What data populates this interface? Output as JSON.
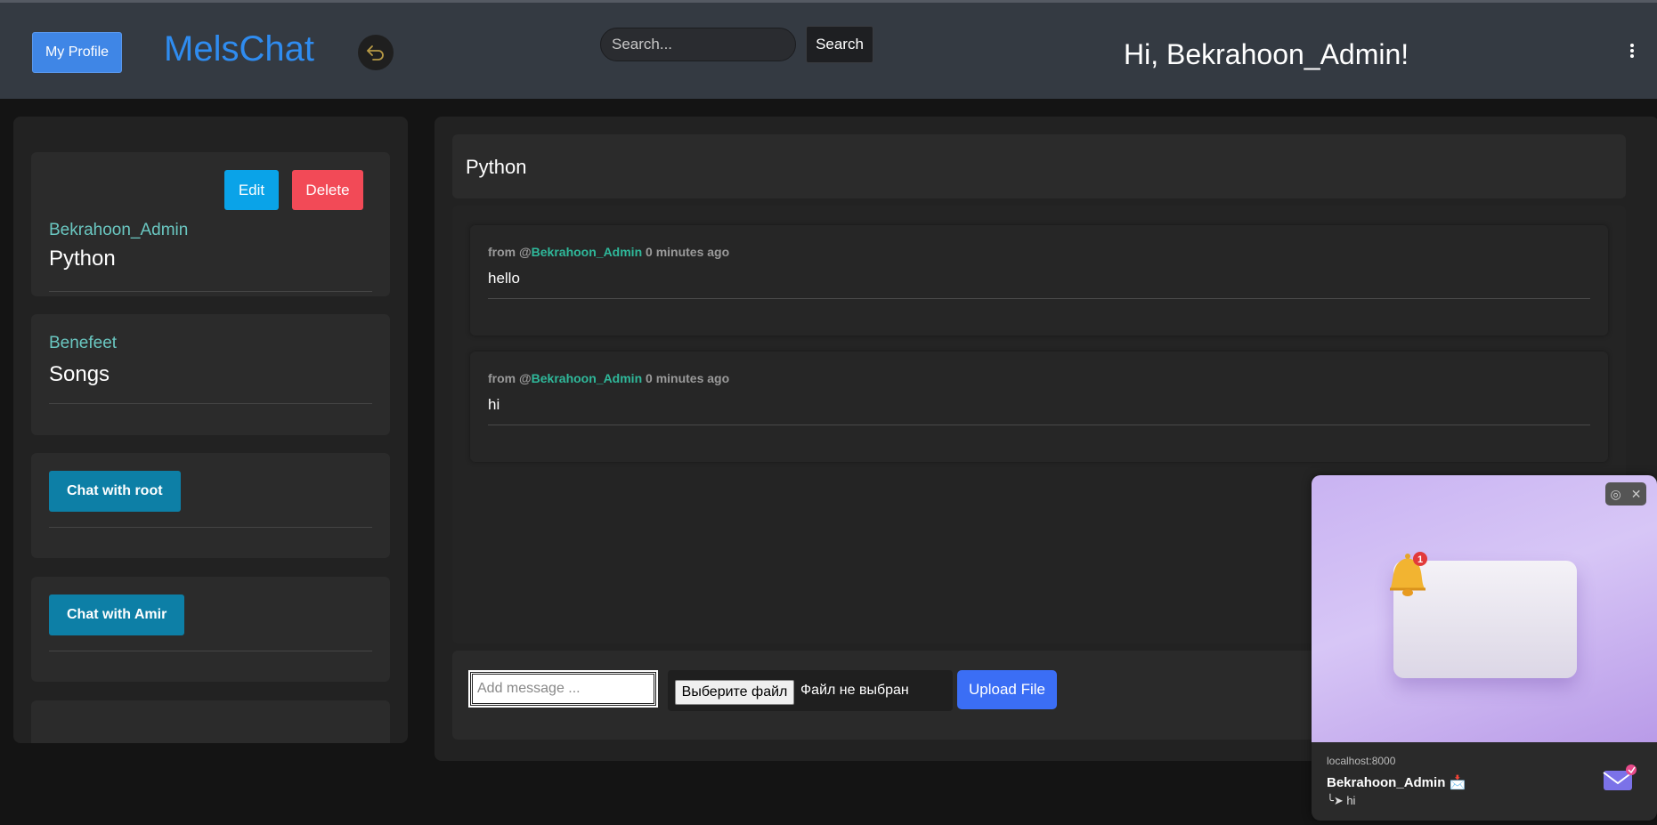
{
  "header": {
    "profile_button": "My Profile",
    "logo": "MelsChat",
    "search_placeholder": "Search...",
    "search_button": "Search",
    "greeting": "Hi, Bekrahoon_Admin!"
  },
  "sidebar": {
    "rooms": [
      {
        "author": "Bekrahoon_Admin",
        "name": "Python",
        "edit_label": "Edit",
        "delete_label": "Delete"
      },
      {
        "author": "Benefeet",
        "name": "Songs"
      }
    ],
    "chats": [
      {
        "label": "Chat with root"
      },
      {
        "label": "Chat with Amir"
      }
    ]
  },
  "main": {
    "room_title": "Python",
    "messages": [
      {
        "from_prefix": "from @",
        "user": "Bekrahoon_Admin",
        "time": "0 minutes ago",
        "text": "hello"
      },
      {
        "from_prefix": "from @",
        "user": "Bekrahoon_Admin",
        "time": "0 minutes ago",
        "text": "hi"
      }
    ],
    "compose": {
      "placeholder": "Add message ...",
      "file_button": "Выберите файл",
      "file_status": "Файл не выбран",
      "upload_button": "Upload File"
    }
  },
  "notification": {
    "host": "localhost:8000",
    "title": "Bekrahoon_Admin 📩",
    "body": "╰➤ hi",
    "badge_count": "1"
  },
  "colors": {
    "accent": "#2f8cf0",
    "author": "#6ac7c1",
    "username": "#2fb89a",
    "edit": "#0aa3e8",
    "delete": "#f24a57",
    "chat": "#0d7fa6",
    "upload": "#3b6ef5"
  }
}
